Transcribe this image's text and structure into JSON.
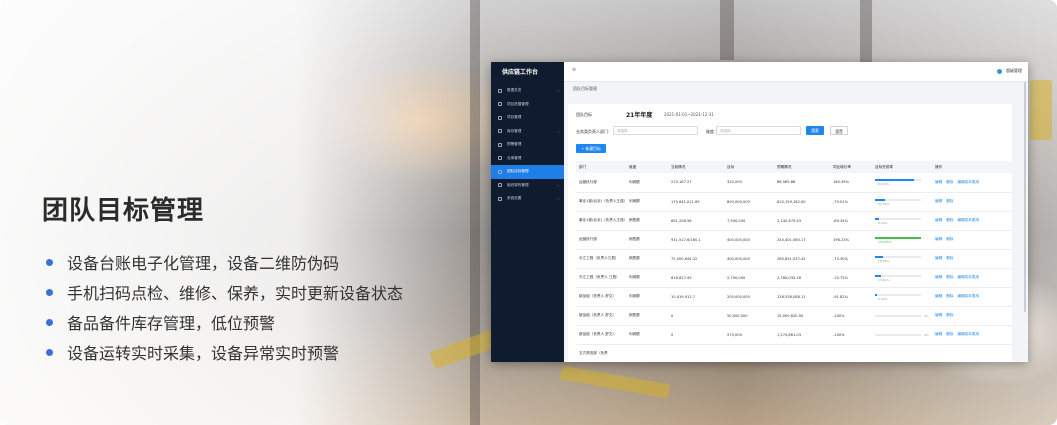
{
  "hero": {
    "title": "团队目标管理",
    "bullets": [
      "设备台账电子化管理，设备二维防伪码",
      "手机扫码点检、维修、保养，实时更新设备状态",
      "备品备件库存管理，低位预警",
      "设备运转实时采集，设备异常实时预警"
    ]
  },
  "app": {
    "brand": "供应链工作台",
    "menu_icon": "≡",
    "user": "超级管理",
    "breadcrumb": "团队目标管理",
    "sidebar": [
      {
        "label": "数据总览",
        "arrow": "‹"
      },
      {
        "label": "项目进展管理"
      },
      {
        "label": "项目管理"
      },
      {
        "label": "库存管理",
        "arrow": "‹"
      },
      {
        "label": "预警管理"
      },
      {
        "label": "仓库管理"
      },
      {
        "label": "团队目标管理",
        "active": true
      },
      {
        "label": "组织架构管理",
        "arrow": "‹"
      },
      {
        "label": "系统设置",
        "arrow": "‹"
      }
    ],
    "filters": {
      "year_label": "团队目标",
      "year_value": "21年年度",
      "date_range": "2021-01-01~2021-12-31",
      "dept_label": "业务类负责人部门：",
      "dept_placeholder": "请选择",
      "status_label": "维度：",
      "status_placeholder": "请选择",
      "search_btn": "搜索",
      "reset_btn": "重置",
      "add_btn": "+ 新建目标"
    },
    "table": {
      "headers": [
        "部门",
        "维度",
        "当前情况",
        "目标",
        "预期情况",
        "同比增长率",
        "目标完成率",
        "操作"
      ],
      "rows": [
        {
          "c": [
            "运营执行部",
            "利润额",
            "270,167.27",
            "320,000",
            "86,565.88",
            "180.39%"
          ],
          "pct": "84.43%",
          "p": 0.84,
          "ops": [
            "编辑",
            "删除",
            "编辑成本费用"
          ]
        },
        {
          "c": [
            "事业1部(北京)（负责人王强）",
            "利润额",
            "179,641,011.69",
            "800,000,000",
            "810,159,182.00",
            "-79.01%"
          ],
          "pct": "22.46%",
          "p": 0.22,
          "ops": [
            "编辑",
            "删除"
          ]
        },
        {
          "c": [
            "事业1部(北京)（负责人王强）",
            "销售额",
            "691,208.56",
            "7,500,000",
            "2,140,675.43",
            "-89.34%"
          ],
          "pct": "9.22%",
          "p": 0.09,
          "ops": [
            "编辑",
            "删除",
            "编辑成本费用"
          ]
        },
        {
          "c": [
            "运营执行部",
            "销售额",
            "931,517.6/160.1",
            "400,000,000",
            "240,401,060.17",
            "196.23%"
          ],
          "pct": "154.95%",
          "p": 1,
          "ops": [
            "编辑",
            "删除"
          ],
          "green": true
        },
        {
          "c": [
            "长江工程（负责人江昌）",
            "销售额",
            "72,000,644.32",
            "400,000,000",
            "280,831,037.42",
            "-73.30%"
          ],
          "pct": "18.04%",
          "p": 0.18,
          "ops": [
            "编辑",
            "删除"
          ]
        },
        {
          "c": [
            "长江工程（负责人 江昌）",
            "利润额",
            "816,827.49",
            "2,700,000",
            "2,780,035.28",
            "-70.72%"
          ],
          "pct": "13.61%",
          "p": 0.14,
          "ops": [
            "编辑",
            "删除",
            "编辑成本费用"
          ]
        },
        {
          "c": [
            "新品组（负责人 舒文）",
            "利润额",
            "10,419,912.7",
            "200,000,000",
            "126,538,088.11",
            "-91.82%"
          ],
          "pct": "5.21%",
          "p": 0.05,
          "ops": [
            "编辑",
            "删除",
            "编辑成本费用"
          ]
        },
        {
          "c": [
            "新品组（负责人 舒文）",
            "销售额",
            "0",
            "50,000,000",
            "15,000,620.90",
            "-100%"
          ],
          "pct": "0%",
          "p": 0,
          "ops": [
            "编辑",
            "删除"
          ]
        },
        {
          "c": [
            "新品组（负责人 舒文）",
            "利润额",
            "0",
            "570,000",
            "1,274,861.03",
            "-100%"
          ],
          "pct": "0%",
          "p": 0,
          "ops": [
            "编辑",
            "删除",
            "编辑成本费用"
          ]
        },
        {
          "c": [
            "五方物流部（负责",
            "",
            "",
            "",
            "",
            ""
          ],
          "pct": "",
          "p": 0,
          "ops": []
        }
      ]
    }
  }
}
